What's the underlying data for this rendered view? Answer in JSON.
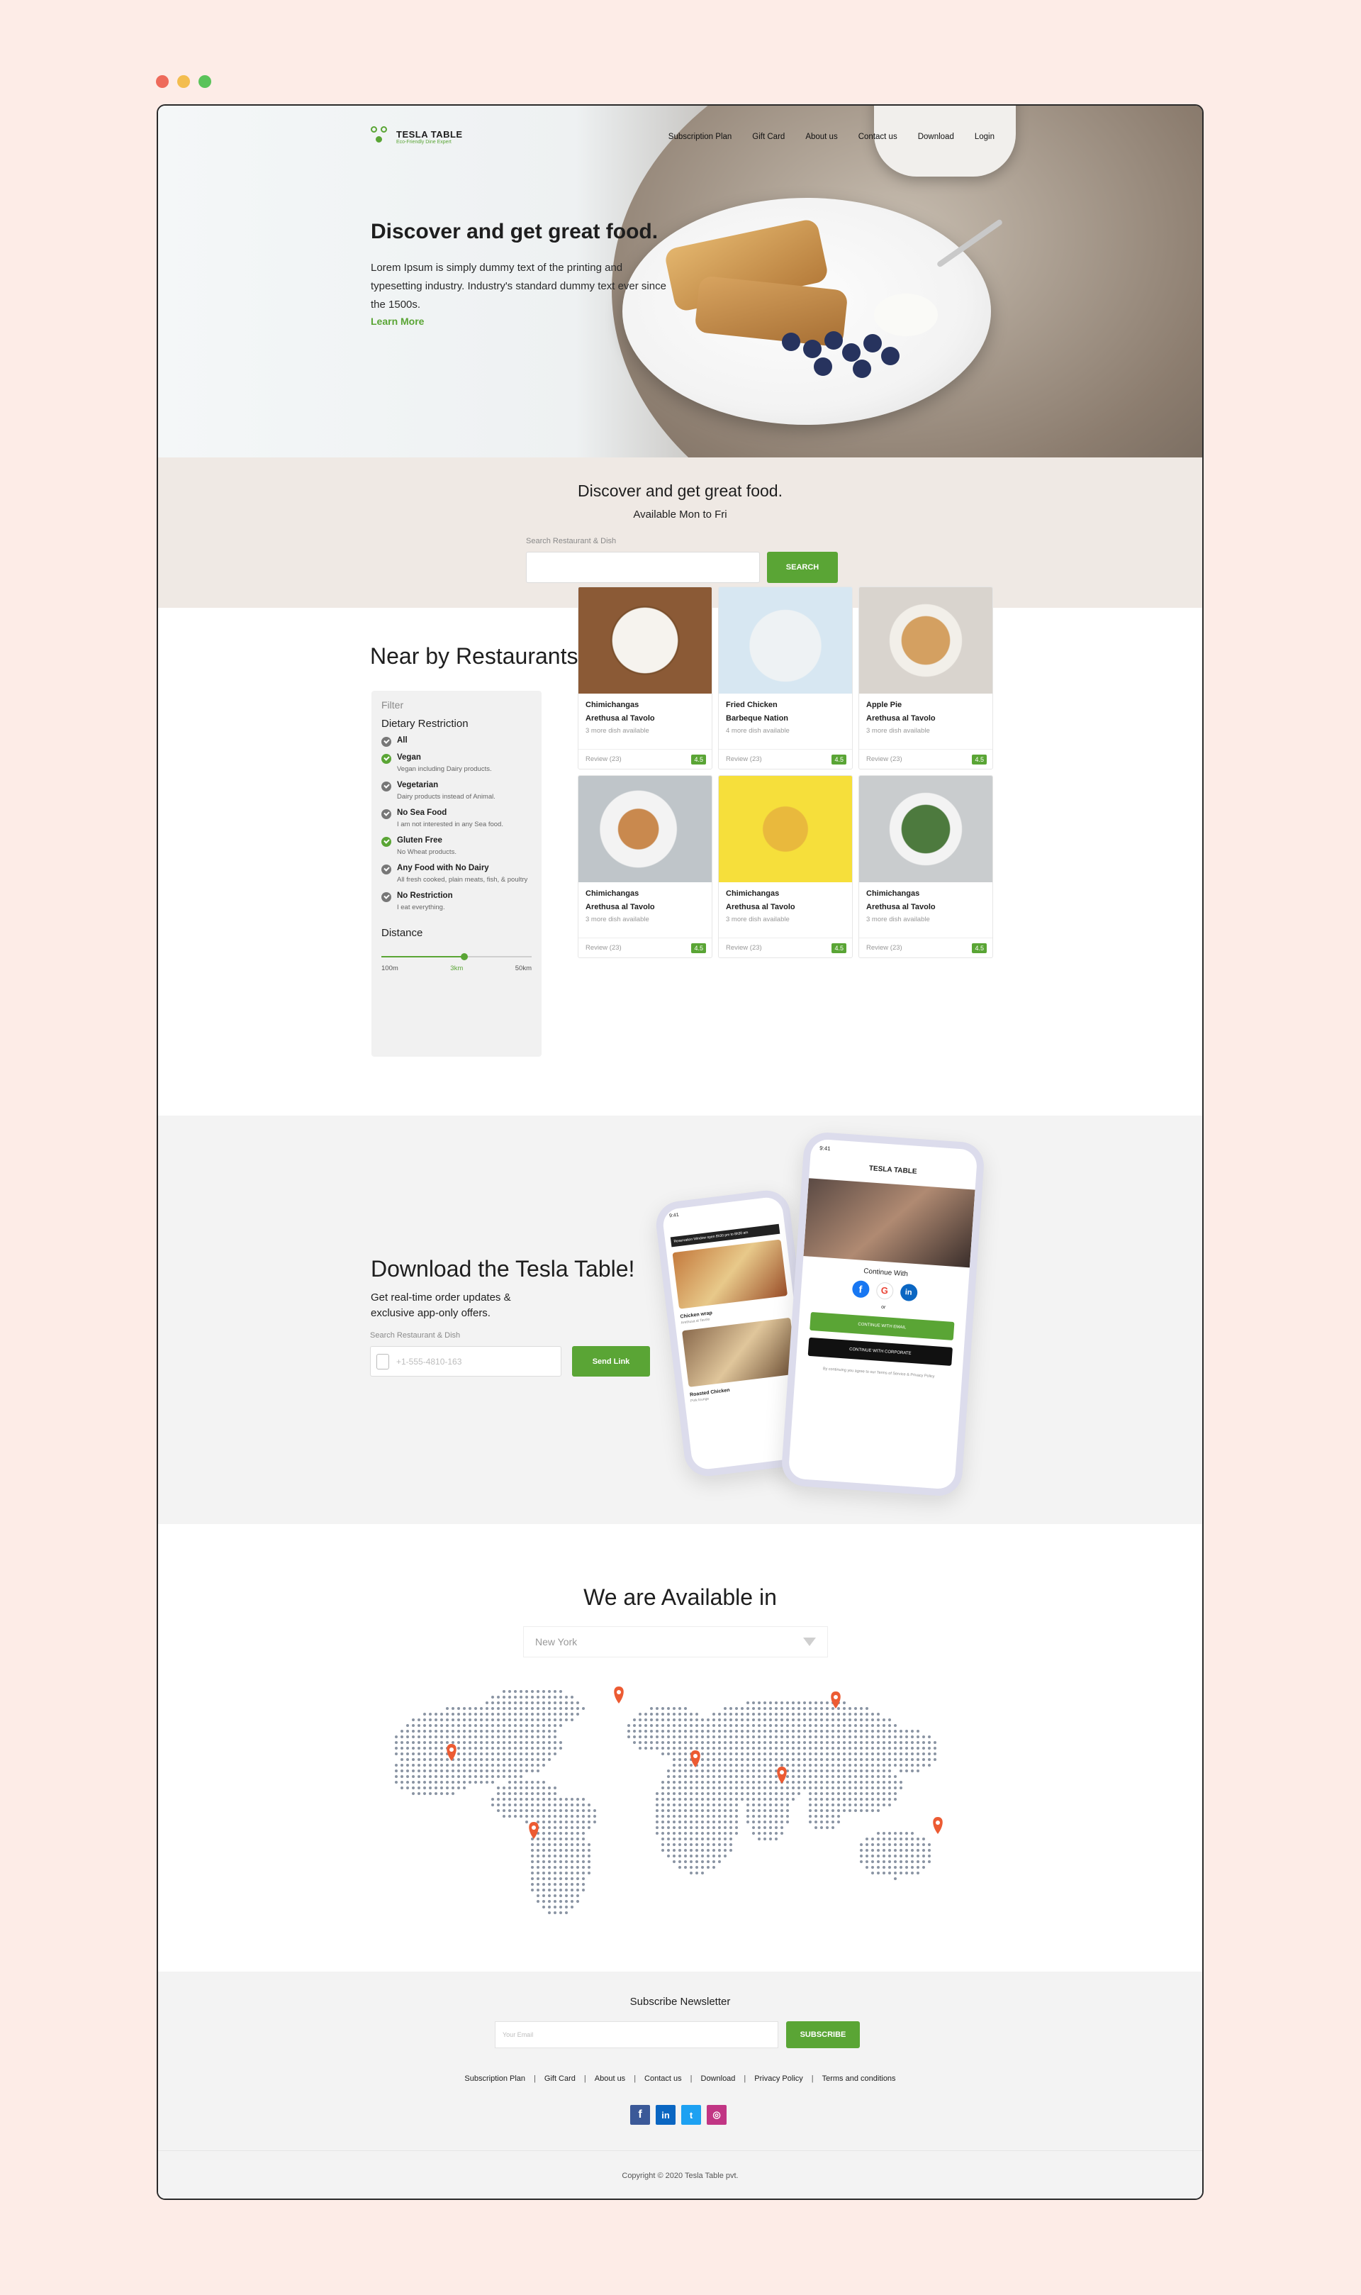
{
  "window_dots": {
    "red": "#ee6a5b",
    "yellow": "#f3bd4f",
    "green": "#5ac35a"
  },
  "colors": {
    "accent": "#5aa535",
    "bg": "#fdece7"
  },
  "brand": {
    "name": "TESLA TABLE",
    "tagline": "Eco-Friendly Dine Expert"
  },
  "nav": [
    "Subscription Plan",
    "Gift Card",
    "About us",
    "Contact us",
    "Download",
    "Login"
  ],
  "hero": {
    "title": "Discover and get great food.",
    "body": "Lorem Ipsum is simply dummy text of the printing and typesetting industry. Industry's standard dummy text ever since the 1500s.",
    "link": "Learn More"
  },
  "search_band": {
    "title": "Discover and get great food.",
    "subtitle": "Available Mon to Fri",
    "label": "Search Restaurant & Dish",
    "button": "SEARCH"
  },
  "restaurants": {
    "title": "Near by Restaurants",
    "filter": {
      "label": "Filter",
      "heading": "Dietary Restriction",
      "options": [
        {
          "title": "All",
          "desc": "",
          "on": false
        },
        {
          "title": "Vegan",
          "desc": "Vegan including Dairy products.",
          "on": true
        },
        {
          "title": "Vegetarian",
          "desc": "Dairy products instead of Animal.",
          "on": false
        },
        {
          "title": "No Sea Food",
          "desc": "I am not interested in any Sea food.",
          "on": false
        },
        {
          "title": "Gluten Free",
          "desc": "No Wheat products.",
          "on": true
        },
        {
          "title": "Any Food with No Dairy",
          "desc": "All fresh cooked, plain meats, fish, & poultry",
          "on": false
        },
        {
          "title": "No Restriction",
          "desc": "I eat everything.",
          "on": false
        }
      ],
      "distance_label": "Distance",
      "distance_ticks": [
        "100m",
        "3km",
        "50km"
      ],
      "distance_value_fraction": 0.55
    },
    "cards": [
      {
        "name": "Chimichangas",
        "place": "Arethusa al Tavolo",
        "more": "3 more dish available",
        "review": "Review (23)",
        "rating": "4.5"
      },
      {
        "name": "Fried Chicken",
        "place": "Barbeque Nation",
        "more": "4 more dish available",
        "review": "Review (23)",
        "rating": "4.5"
      },
      {
        "name": "Apple Pie",
        "place": "Arethusa al Tavolo",
        "more": "3 more dish available",
        "review": "Review (23)",
        "rating": "4.5"
      },
      {
        "name": "Chimichangas",
        "place": "Arethusa al Tavolo",
        "more": "3 more dish available",
        "review": "Review (23)",
        "rating": "4.5"
      },
      {
        "name": "Chimichangas",
        "place": "Arethusa al Tavolo",
        "more": "3 more dish available",
        "review": "Review (23)",
        "rating": "4.5"
      },
      {
        "name": "Chimichangas",
        "place": "Arethusa al Tavolo",
        "more": "3 more dish available",
        "review": "Review (23)",
        "rating": "4.5"
      }
    ]
  },
  "download": {
    "title": "Download the Tesla Table!",
    "body": "Get real-time order updates & exclusive app-only offers.",
    "label": "Search Restaurant & Dish",
    "placeholder": "+1-555-4810-163",
    "button": "Send Link",
    "phone_small": {
      "time": "9:41",
      "banner": "Reservation Window open 8h30 pm to 8h30 am",
      "item1": "Chicken wrap",
      "item1_sub": "Arethusa al Tavolo",
      "item2": "Roasted Chicken",
      "item2_sub": "Pink lounge"
    },
    "phone_large": {
      "time": "9:41",
      "brand": "TESLA TABLE",
      "continue": "Continue With",
      "or": "or",
      "btn1": "CONTINUE WITH EMAIL",
      "btn2": "CONTINUE WITH CORPORATE",
      "terms": "By continuing you agree to our Terms of Service & Privacy Policy"
    }
  },
  "available": {
    "title": "We are Available in",
    "city": "New York"
  },
  "footer": {
    "newsletter": "Subscribe Newsletter",
    "email_placeholder": "Your Email",
    "subscribe": "SUBSCRIBE",
    "links": [
      "Subscription Plan",
      "Gift Card",
      "About us",
      "Contact us",
      "Download",
      "Privacy Policy",
      "Terms and conditions"
    ],
    "social": [
      "facebook-icon",
      "linkedin-icon",
      "twitter-icon",
      "instagram-icon"
    ],
    "copyright": "Copyright © 2020 Tesla Table pvt."
  }
}
